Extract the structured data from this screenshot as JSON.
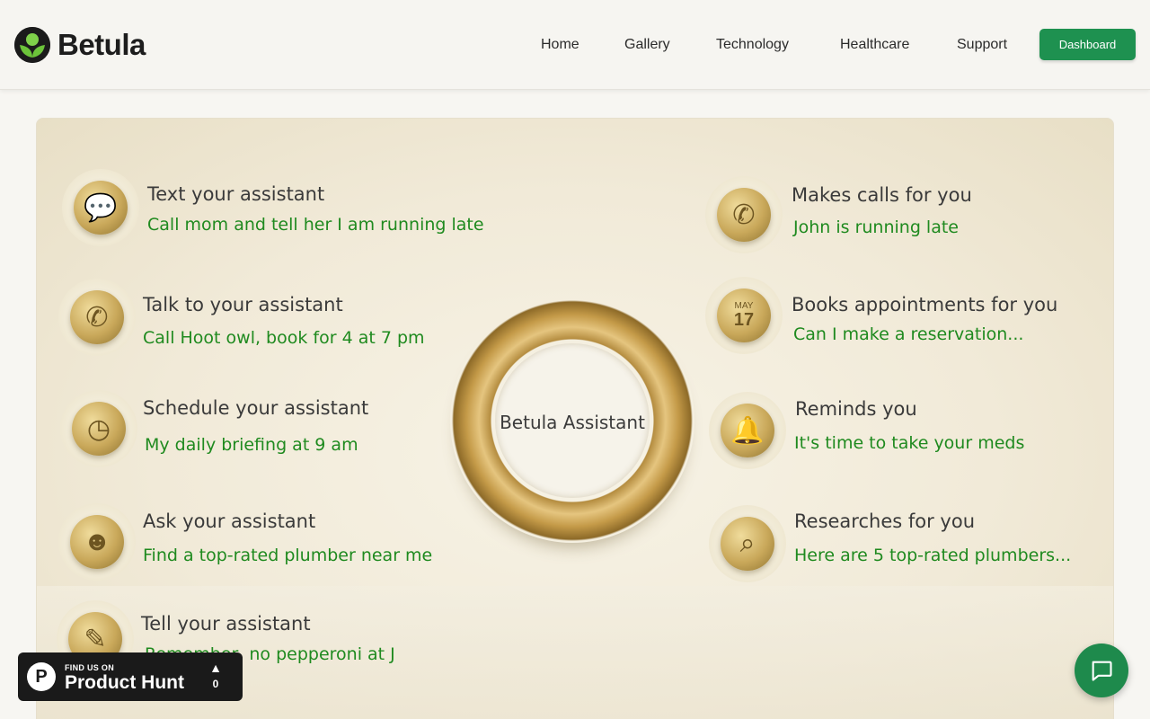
{
  "brand": {
    "name": "Betula",
    "accent": "#1e9150"
  },
  "nav": {
    "links": [
      "Home",
      "Gallery",
      "Technology",
      "Healthcare",
      "Support"
    ],
    "dashboard_label": "Dashboard"
  },
  "hero": {
    "center_label": "Betula Assistant",
    "left_features": [
      {
        "title": "Text your assistant",
        "subtitle": "Call mom and tell her I am running late",
        "icon": "chat-bubble-icon"
      },
      {
        "title": "Talk to your assistant",
        "subtitle": "Call Hoot owl, book for 4 at 7 pm",
        "icon": "phone-icon"
      },
      {
        "title": "Schedule your assistant",
        "subtitle": "My daily briefing at 9 am",
        "icon": "clock-icon"
      },
      {
        "title": "Ask your assistant",
        "subtitle": "Find a top-rated plumber near me",
        "icon": "head-icon"
      },
      {
        "title": "Tell your assistant",
        "subtitle": "Remember, no pepperoni at J",
        "icon": "note-icon"
      }
    ],
    "right_features": [
      {
        "title": "Makes calls for you",
        "subtitle": "John is running late",
        "icon": "phone-outgoing-icon"
      },
      {
        "title": "Books appointments for you",
        "subtitle": "Can I make a reservation...",
        "icon": "calendar-icon",
        "calendar_month": "MAY",
        "calendar_day": "17"
      },
      {
        "title": "Reminds you",
        "subtitle": "It's time to take your meds",
        "icon": "bell-icon"
      },
      {
        "title": "Researches for you",
        "subtitle": "Here are 5 top-rated plumbers...",
        "icon": "magnifier-icon"
      }
    ]
  },
  "product_hunt": {
    "small": "FIND US ON",
    "big": "Product Hunt",
    "count": "0",
    "logo_letter": "P"
  }
}
